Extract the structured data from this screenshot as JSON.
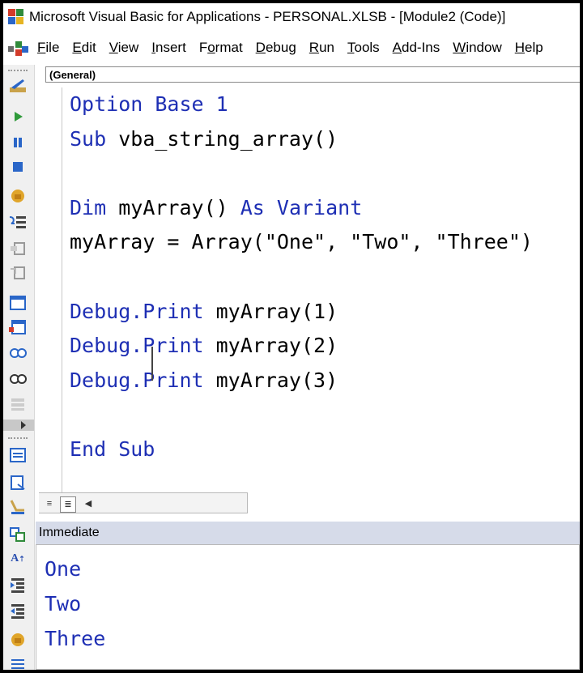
{
  "window": {
    "title": "Microsoft Visual Basic for Applications - PERSONAL.XLSB - [Module2 (Code)]"
  },
  "menu": {
    "items": [
      {
        "pre": "",
        "u": "F",
        "post": "ile"
      },
      {
        "pre": "",
        "u": "E",
        "post": "dit"
      },
      {
        "pre": "",
        "u": "V",
        "post": "iew"
      },
      {
        "pre": "",
        "u": "I",
        "post": "nsert"
      },
      {
        "pre": "F",
        "u": "o",
        "post": "rmat"
      },
      {
        "pre": "",
        "u": "D",
        "post": "ebug"
      },
      {
        "pre": "",
        "u": "R",
        "post": "un"
      },
      {
        "pre": "",
        "u": "T",
        "post": "ools"
      },
      {
        "pre": "",
        "u": "A",
        "post": "dd-Ins"
      },
      {
        "pre": "",
        "u": "W",
        "post": "indow"
      },
      {
        "pre": "",
        "u": "H",
        "post": "elp"
      }
    ]
  },
  "object_dropdown": {
    "value": "(General)"
  },
  "code": {
    "lines": [
      [
        {
          "t": "Option Base 1",
          "k": true
        }
      ],
      [
        {
          "t": "Sub ",
          "k": true
        },
        {
          "t": "vba_string_array()",
          "k": false
        }
      ],
      [],
      [
        {
          "t": "Dim ",
          "k": true
        },
        {
          "t": "myArray() ",
          "k": false
        },
        {
          "t": "As Variant",
          "k": true
        }
      ],
      [
        {
          "t": "myArray = Array(\"One\", \"Two\", \"Three\")",
          "k": false
        }
      ],
      [],
      [
        {
          "t": "Debug.Print ",
          "k": true
        },
        {
          "t": "myArray(1)",
          "k": false
        }
      ],
      [
        {
          "t": "Debug.Print ",
          "k": true
        },
        {
          "t": "myArray(2)",
          "k": false
        }
      ],
      [
        {
          "t": "Debug.Print ",
          "k": true
        },
        {
          "t": "myArray(3)",
          "k": false
        }
      ],
      [],
      [
        {
          "t": "End Sub",
          "k": true
        }
      ]
    ]
  },
  "immediate": {
    "title": "Immediate",
    "output": [
      "One",
      "Two",
      "Three"
    ]
  },
  "toolbar_icons": [
    "design-mode-icon",
    "run-icon",
    "break-icon",
    "reset-icon",
    "toggle-breakpoint-icon",
    "step-into-icon",
    "step-over-icon",
    "step-out-icon",
    "userform-icon",
    "userform-close-icon",
    "watch-icon",
    "quick-watch-icon",
    "call-stack-icon",
    "toolbar-expand-icon",
    "object-browser-icon",
    "insert-module-icon",
    "run-to-cursor-icon",
    "find-replace-icon",
    "font-size-icon",
    "indent-icon",
    "outdent-icon",
    "hand-icon",
    "list-icon"
  ],
  "colors": {
    "keyword": "#1e2fb4",
    "immediate_header": "#d6dbe9"
  }
}
